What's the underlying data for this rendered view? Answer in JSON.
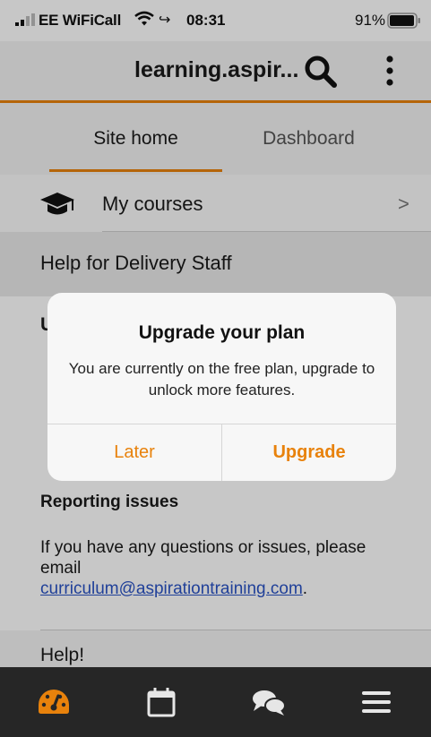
{
  "status_bar": {
    "carrier": "EE WiFiCall",
    "time": "08:31",
    "battery": "91%",
    "icons": [
      "signal-icon",
      "wifi-icon",
      "wifi-call-icon",
      "battery-icon"
    ]
  },
  "header": {
    "title": "learning.aspir...",
    "icons": [
      "search-icon",
      "more-vertical-icon"
    ],
    "accent_color": "#e8820c"
  },
  "tabs": [
    {
      "label": "Site home",
      "active": true
    },
    {
      "label": "Dashboard",
      "active": false
    }
  ],
  "content": {
    "my_courses": {
      "label": "My courses",
      "icon": "graduation-cap-icon",
      "chevron": ">"
    },
    "section_title": "Help for Delivery Staff",
    "partial_heading": "U",
    "reporting": {
      "title": "Reporting issues",
      "body": "If you have any questions or issues, please email",
      "email": "curriculum@aspirationtraining.com",
      "suffix": "."
    },
    "help_label": "Help!"
  },
  "dialog": {
    "title": "Upgrade your plan",
    "message": "You are currently on the free plan, upgrade to unlock more features.",
    "later_label": "Later",
    "upgrade_label": "Upgrade"
  },
  "bottom_nav": {
    "items": [
      "dashboard-icon",
      "calendar-icon",
      "messages-icon",
      "menu-icon"
    ],
    "active_color": "#e8820c",
    "inactive_color": "#e6e6e6"
  }
}
